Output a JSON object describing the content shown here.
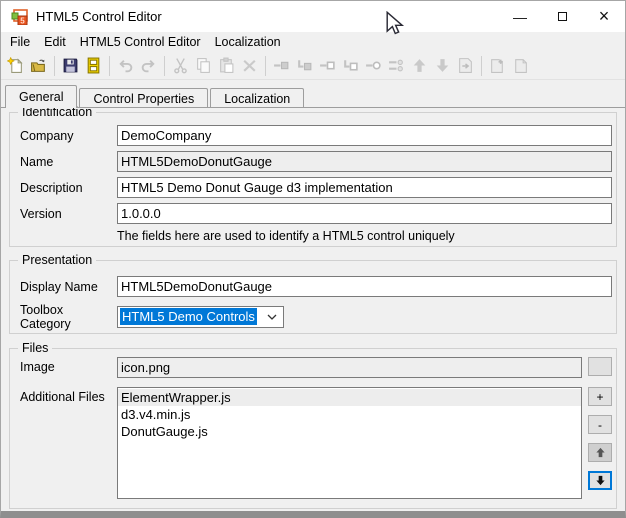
{
  "window": {
    "title": "HTML5 Control Editor",
    "controls": {
      "minimize": "—",
      "close": "×"
    }
  },
  "menu": {
    "items": [
      "File",
      "Edit",
      "HTML5 Control Editor",
      "Localization"
    ]
  },
  "toolbar": {
    "buttons": [
      {
        "name": "new-document",
        "enabled": true
      },
      {
        "name": "open",
        "enabled": true
      },
      {
        "name": "separator"
      },
      {
        "name": "save",
        "enabled": true
      },
      {
        "name": "save-control-library",
        "enabled": true
      },
      {
        "name": "separator"
      },
      {
        "name": "undo",
        "enabled": false
      },
      {
        "name": "redo",
        "enabled": false
      },
      {
        "name": "separator"
      },
      {
        "name": "cut",
        "enabled": false
      },
      {
        "name": "copy",
        "enabled": false
      },
      {
        "name": "paste",
        "enabled": false
      },
      {
        "name": "delete",
        "enabled": false
      },
      {
        "name": "separator"
      },
      {
        "name": "link-property",
        "enabled": false
      },
      {
        "name": "link-event",
        "enabled": false
      },
      {
        "name": "link-property-empty",
        "enabled": false
      },
      {
        "name": "link-event-empty",
        "enabled": false
      },
      {
        "name": "link-method",
        "enabled": false
      },
      {
        "name": "link-list",
        "enabled": false
      },
      {
        "name": "move-up",
        "enabled": false
      },
      {
        "name": "move-down",
        "enabled": false
      },
      {
        "name": "generate-file",
        "enabled": false
      },
      {
        "name": "separator"
      },
      {
        "name": "add-localization",
        "enabled": false
      },
      {
        "name": "export-localization",
        "enabled": false
      }
    ]
  },
  "tabs": {
    "items": [
      "General",
      "Control Properties",
      "Localization"
    ],
    "active": "General"
  },
  "identification": {
    "legend": "Identification",
    "company": {
      "label": "Company",
      "value": "DemoCompany"
    },
    "name": {
      "label": "Name",
      "value": "HTML5DemoDonutGauge"
    },
    "description": {
      "label": "Description",
      "value": "HTML5 Demo Donut Gauge d3 implementation"
    },
    "version": {
      "label": "Version",
      "value": "1.0.0.0"
    },
    "note": "The fields here are used to identify a HTML5 control uniquely"
  },
  "presentation": {
    "legend": "Presentation",
    "display_name": {
      "label": "Display Name",
      "value": "HTML5DemoDonutGauge"
    },
    "toolbox_category": {
      "label": "Toolbox Category",
      "value": "HTML5 Demo Controls"
    }
  },
  "files": {
    "legend": "Files",
    "image": {
      "label": "Image",
      "value": "icon.png"
    },
    "additional_files": {
      "label": "Additional Files",
      "items": [
        "ElementWrapper.js",
        "d3.v4.min.js",
        "DonutGauge.js"
      ],
      "selected_index": 0
    },
    "list_buttons": {
      "add": "+",
      "remove": "-"
    }
  },
  "colors": {
    "accent": "#0078d7",
    "window_bg": "#f0f0f0",
    "titlebar_bg": "#ffffff"
  }
}
